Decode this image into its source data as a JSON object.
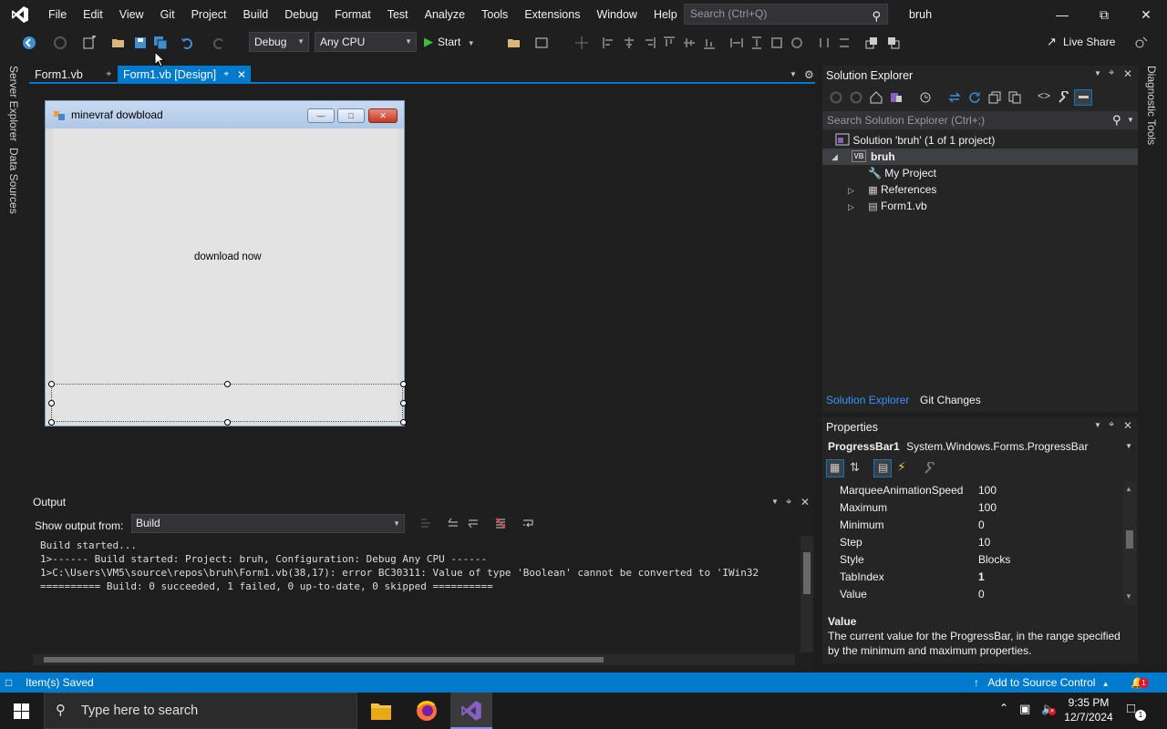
{
  "menubar": {
    "items": [
      "File",
      "Edit",
      "View",
      "Git",
      "Project",
      "Build",
      "Debug",
      "Format",
      "Test",
      "Analyze",
      "Tools",
      "Extensions",
      "Window",
      "Help"
    ],
    "search_placeholder": "Search (Ctrl+Q)",
    "solution_title": "bruh"
  },
  "toolbar": {
    "config": "Debug",
    "platform": "Any CPU",
    "start_label": "Start",
    "live_share": "Live Share"
  },
  "left_tabs": [
    "Server Explorer",
    "Data Sources"
  ],
  "right_tabs": [
    "Diagnostic Tools"
  ],
  "doc_tabs": [
    {
      "label": "Form1.vb",
      "active": false
    },
    {
      "label": "Form1.vb [Design]",
      "active": true
    }
  ],
  "form": {
    "title": "minevraf dowbload",
    "label": "download now"
  },
  "output": {
    "title": "Output",
    "show_from_label": "Show output from:",
    "source": "Build",
    "lines": [
      "Build started...",
      "1>------ Build started: Project: bruh, Configuration: Debug Any CPU ------",
      "1>C:\\Users\\VM5\\source\\repos\\bruh\\Form1.vb(38,17): error BC30311: Value of type 'Boolean' cannot be converted to 'IWin32",
      "========== Build: 0 succeeded, 1 failed, 0 up-to-date, 0 skipped =========="
    ]
  },
  "solution_explorer": {
    "title": "Solution Explorer",
    "search_placeholder": "Search Solution Explorer (Ctrl+;)",
    "solution": "Solution 'bruh' (1 of 1 project)",
    "project": "bruh",
    "items": [
      "My Project",
      "References",
      "Form1.vb"
    ],
    "bottom_tabs": [
      "Solution Explorer",
      "Git Changes"
    ]
  },
  "properties": {
    "title": "Properties",
    "object_name": "ProgressBar1",
    "object_type": "System.Windows.Forms.ProgressBar",
    "rows": [
      {
        "name": "MarqueeAnimationSpeed",
        "value": "100"
      },
      {
        "name": "Maximum",
        "value": "100"
      },
      {
        "name": "Minimum",
        "value": "0"
      },
      {
        "name": "Step",
        "value": "10"
      },
      {
        "name": "Style",
        "value": "Blocks"
      },
      {
        "name": "TabIndex",
        "value": "1"
      },
      {
        "name": "Value",
        "value": "0"
      }
    ],
    "desc_title": "Value",
    "desc_text": "The current value for the ProgressBar, in the range specified by the minimum and maximum properties."
  },
  "statusbar": {
    "message": "Item(s) Saved",
    "source_control": "Add to Source Control",
    "notifications": "1"
  },
  "taskbar": {
    "search_placeholder": "Type here to search",
    "time": "9:35 PM",
    "date": "12/7/2024",
    "notification_count": "1"
  },
  "colors": {
    "accent": "#007acc",
    "vs_purple": "#865fc5"
  }
}
